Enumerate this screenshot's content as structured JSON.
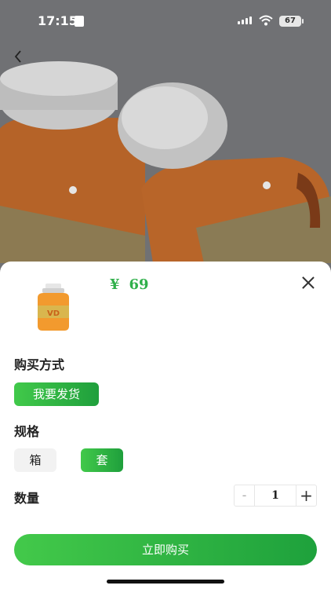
{
  "status_bar": {
    "time": "17:15",
    "battery": "67"
  },
  "icons": {
    "back": "chevron-left-icon",
    "close": "close-icon",
    "wifi": "wifi-icon",
    "signal": "signal-icon"
  },
  "product": {
    "price_symbol": "¥",
    "price_value": "69"
  },
  "purchase_method": {
    "title": "购买方式",
    "options": [
      "我要发货"
    ],
    "selected": "我要发货"
  },
  "spec": {
    "title": "规格",
    "options": [
      "箱",
      "套"
    ],
    "selected": "套"
  },
  "quantity": {
    "title": "数量",
    "minus": "-",
    "value": "1",
    "plus": "+"
  },
  "buy_button": {
    "label": "立即购买"
  },
  "colors": {
    "accent_green": "#2fb04a",
    "button_gradient_start": "#43c94a",
    "button_gradient_end": "#1ea13c"
  }
}
